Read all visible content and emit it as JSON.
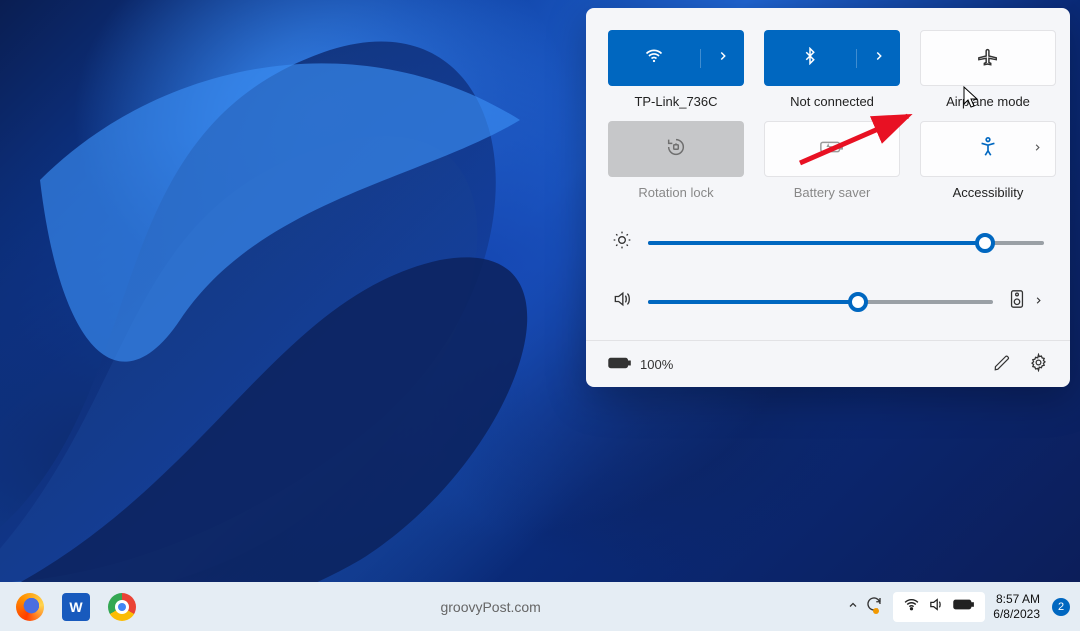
{
  "panel": {
    "tiles": [
      {
        "id": "wifi",
        "label": "TP-Link_736C",
        "icon": "wifi-icon",
        "state": "on",
        "split": true
      },
      {
        "id": "bluetooth",
        "label": "Not connected",
        "icon": "bluetooth-icon",
        "state": "on",
        "split": true
      },
      {
        "id": "airplane",
        "label": "Airplane mode",
        "icon": "airplane-icon",
        "state": "off",
        "split": false
      },
      {
        "id": "rotation",
        "label": "Rotation lock",
        "icon": "rotation-lock-icon",
        "state": "disabled",
        "split": false
      },
      {
        "id": "battery-saver",
        "label": "Battery saver",
        "icon": "battery-saver-icon",
        "state": "off-light",
        "split": false
      },
      {
        "id": "accessibility",
        "label": "Accessibility",
        "icon": "accessibility-icon",
        "state": "access",
        "split": false,
        "hasChevron": true
      }
    ],
    "sliders": {
      "brightness": {
        "value": 85
      },
      "volume": {
        "value": 61
      }
    },
    "footer": {
      "battery_pct": "100%"
    }
  },
  "taskbar": {
    "watermark": "groovyPost.com",
    "clock_time": "8:57 AM",
    "clock_date": "6/8/2023",
    "notification_count": "2"
  }
}
